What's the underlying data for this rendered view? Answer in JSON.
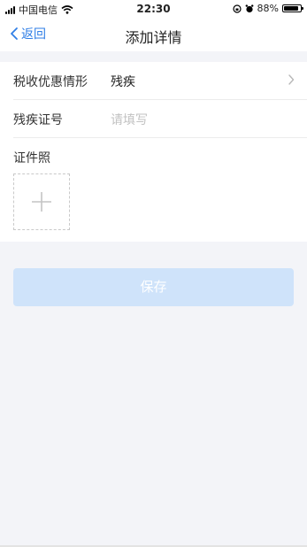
{
  "status": {
    "carrier": "中国电信",
    "time": "22:30",
    "battery_percent": "88%",
    "battery_level": 0.88
  },
  "nav": {
    "back_label": "返回",
    "title": "添加详情"
  },
  "form": {
    "tax_situation": {
      "label": "税收优惠情形",
      "value": "残疾"
    },
    "certificate_no": {
      "label": "残疾证号",
      "placeholder": "请填写"
    },
    "photo": {
      "label": "证件照"
    }
  },
  "actions": {
    "save_label": "保存"
  },
  "colors": {
    "accent": "#2f7ee6",
    "button_disabled_bg": "#cfe3fa",
    "page_bg": "#f3f4f8"
  }
}
